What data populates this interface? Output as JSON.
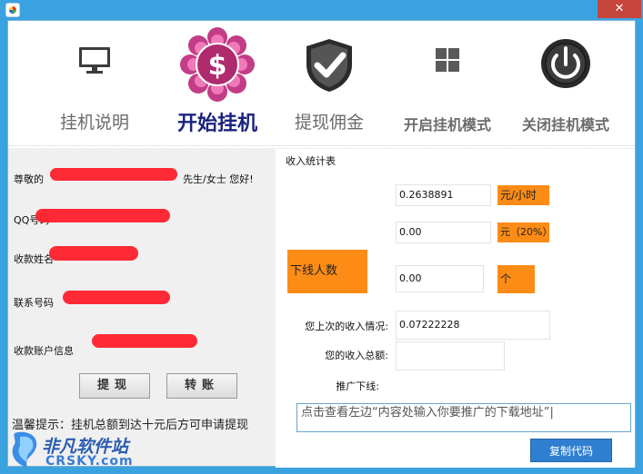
{
  "titlebar": {
    "close_glyph": "✕"
  },
  "toolbar": {
    "items": [
      {
        "label": "挂机说明",
        "icon": "monitor-icon"
      },
      {
        "label": "开始挂机",
        "icon": "dollar-flower-icon"
      },
      {
        "label": "提现佣金",
        "icon": "shield-check-icon"
      },
      {
        "label": "开启挂机模式",
        "icon": "windows-logo-icon"
      },
      {
        "label": "关闭挂机模式",
        "icon": "power-icon"
      }
    ]
  },
  "left": {
    "greeting_prefix": "尊敬的",
    "greeting_suffix": "先生/女士    您好!",
    "qq_label": "QQ号码",
    "payee_name_label": "收款姓名",
    "phone_label": "联系号码",
    "account_label": "收款账户信息",
    "withdraw_button": "提现",
    "transfer_button": "转账",
    "tip": "温馨提示：挂机总额到达十元后方可申请提现"
  },
  "stats": {
    "group_title": "收入统计表",
    "rate_value": "0.2638891",
    "rate_unit": "元/小时",
    "commission_value": "0.00",
    "commission_unit": "元（20%）",
    "downline_label": "下线人数",
    "downline_value": "0.00",
    "downline_unit": "个",
    "last_income_label": "您上次的收入情况:",
    "last_income_value": "0.07222228",
    "total_income_label": "您的收入总额:",
    "total_income_value": "",
    "promote_label": "推广下线:",
    "promote_text": "点击查看左边“内容处输入你要推广的下载地址”|",
    "copy_button": "复制代码"
  },
  "watermark": {
    "cn": "非凡软件站",
    "en": "CRSKY.com"
  },
  "colors": {
    "accent_orange": "#fd8c16",
    "frame_blue": "#3aa2df",
    "close_red": "#c7463b",
    "button_blue": "#2f7fd1",
    "redaction": "#ff1f2a"
  }
}
